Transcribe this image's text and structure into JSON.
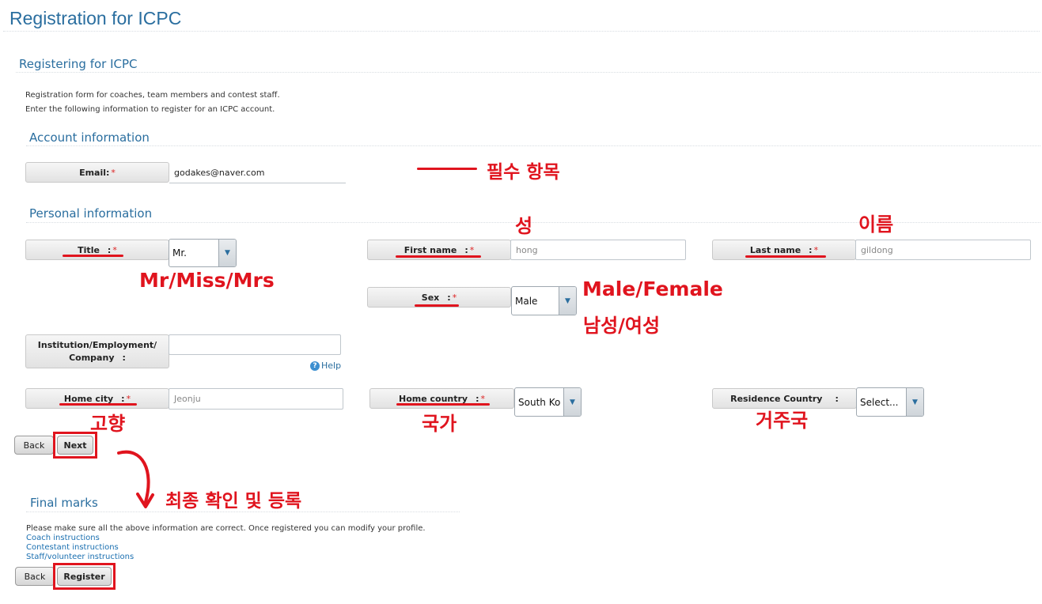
{
  "header": {
    "title": "Registration for ICPC"
  },
  "form": {
    "subtitle": "Registering for ICPC",
    "intro_line1": "Registration form for coaches, team members and contest staff.",
    "intro_line2": "Enter the following information to register for an ICPC account."
  },
  "account": {
    "section_title": "Account information",
    "email_label": "Email:",
    "email_value": "godakes@naver.com"
  },
  "personal": {
    "section_title": "Personal information",
    "title_label": "Title",
    "title_value": "Mr.",
    "first_name_label": "First name",
    "first_name_value": "hong",
    "last_name_label": "Last name",
    "last_name_value": "gildong",
    "sex_label": "Sex",
    "sex_value": "Male",
    "institution_label_line1": "Institution/Employment/",
    "institution_label_line2": "Company",
    "institution_value": "",
    "help_label": "Help",
    "home_city_label": "Home city",
    "home_city_value": "Jeonju",
    "home_country_label": "Home country",
    "home_country_value": "South Ko",
    "residence_country_label": "Residence Country",
    "residence_country_value": "Select..."
  },
  "labels": {
    "required_mark": "*",
    "colon": ":"
  },
  "nav": {
    "back_label": "Back",
    "next_label": "Next"
  },
  "final": {
    "section_title": "Final marks",
    "notice": "Please make sure all the above information are correct. Once registered you can modify your profile.",
    "links": [
      "Coach instructions",
      "Contestant instructions",
      "Staff/volunteer instructions"
    ],
    "back_label": "Back",
    "register_label": "Register"
  },
  "annotations": {
    "required_field": "필수 항목",
    "first_name": "성",
    "last_name": "이름",
    "title_options": "Mr/Miss/Mrs",
    "sex_options_en": "Male/Female",
    "sex_options_ko": "남성/여성",
    "home_city": "고향",
    "home_country": "국가",
    "residence_country": "거주국",
    "final_register": "최종 확인 및 등록"
  },
  "colors": {
    "annotation_red": "#e0141e",
    "heading_blue": "#2a6e9f",
    "link_blue": "#1a6fb0"
  },
  "icons": {
    "dropdown": "triangle-down",
    "help": "question-circle",
    "arrow": "curved-arrow-down"
  }
}
